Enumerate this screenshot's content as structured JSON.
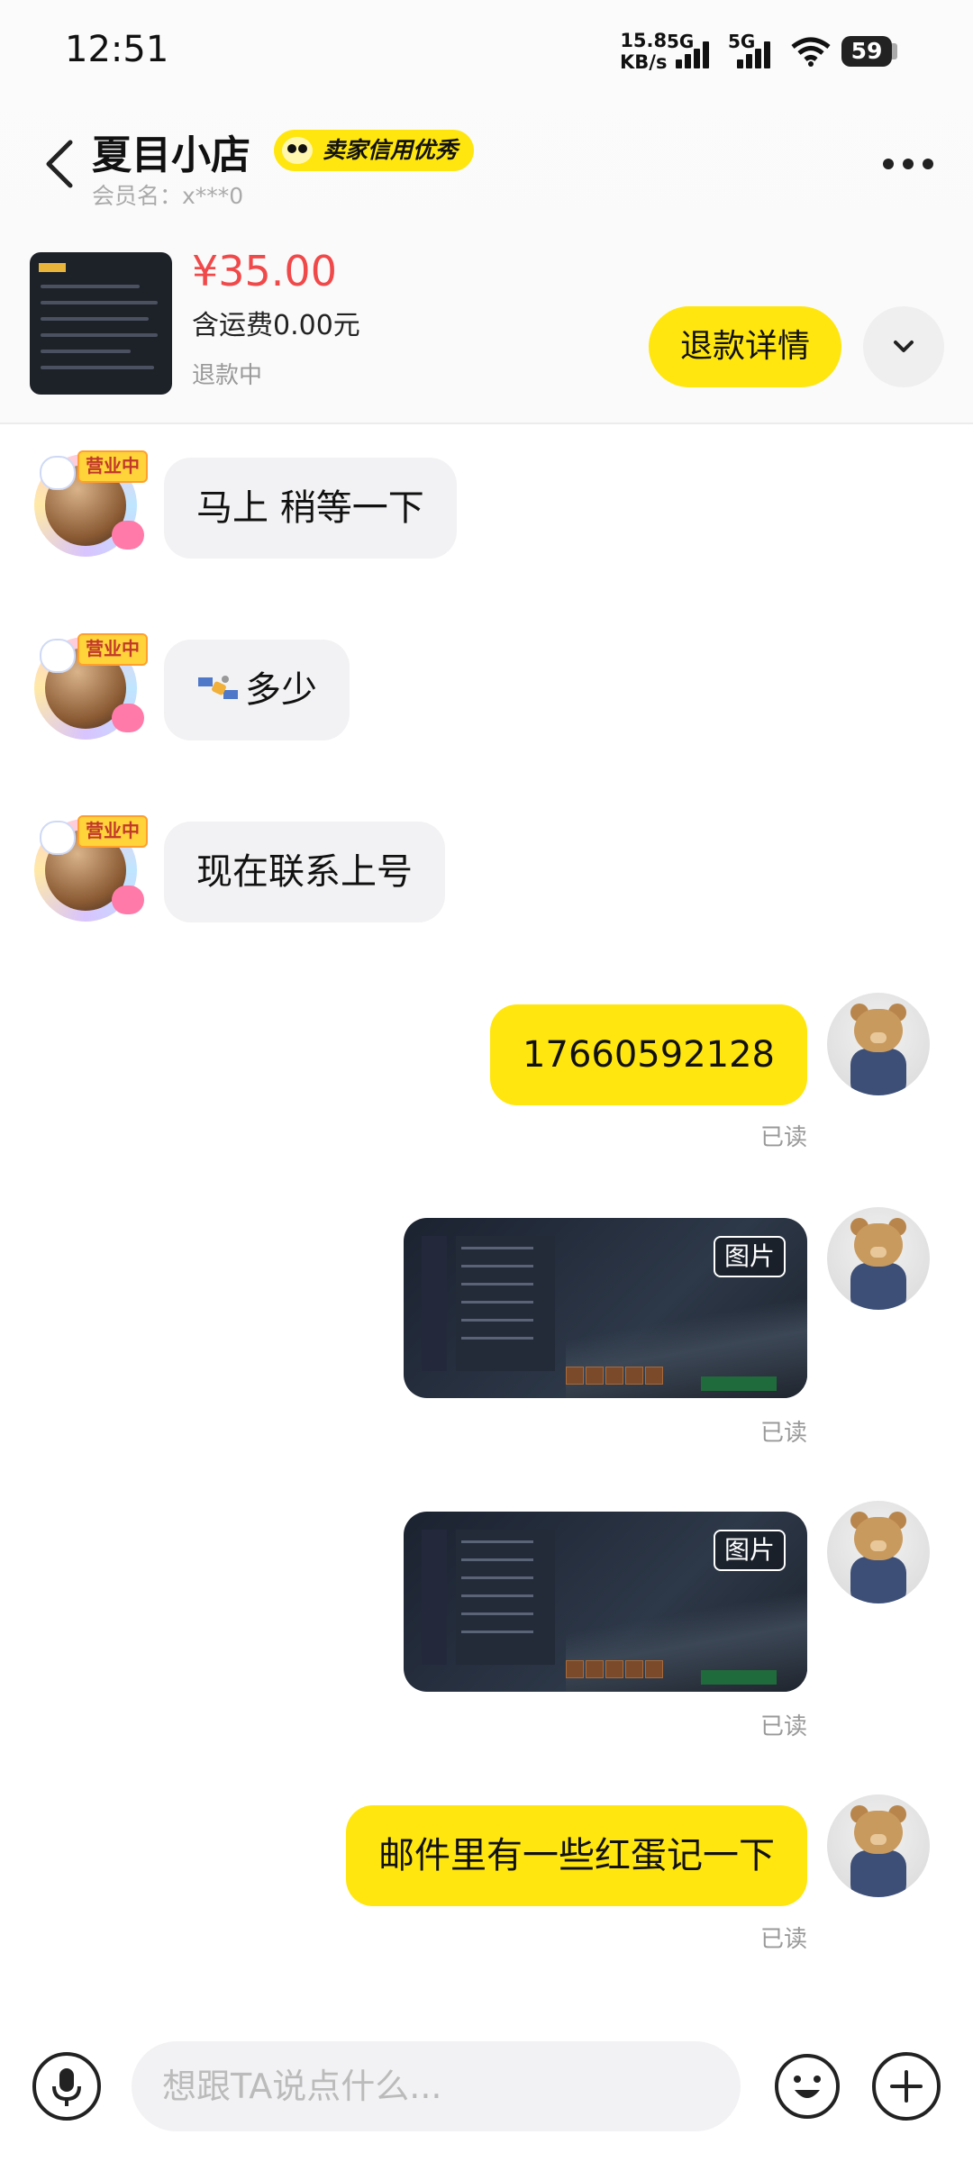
{
  "status_bar": {
    "time": "12:51",
    "speed_value": "15.8",
    "speed_unit": "KB/s",
    "net1": "5G",
    "net2": "5G",
    "battery": "59"
  },
  "header": {
    "shop_name": "夏目小店",
    "credit_badge": "卖家信用优秀",
    "member_label": "会员名：x***0"
  },
  "product": {
    "price": "¥35.00",
    "shipping": "含运费0.00元",
    "status": "退款中",
    "refund_button": "退款详情"
  },
  "messages": [
    {
      "side": "left",
      "text": "马上 稍等一下",
      "avatar_tag": "营业中"
    },
    {
      "side": "left",
      "text": "多少",
      "avatar_tag": "营业中"
    },
    {
      "side": "left",
      "text": "现在联系上号",
      "avatar_tag": "营业中"
    },
    {
      "side": "right",
      "text": "17660592128",
      "read": "已读"
    },
    {
      "side": "right",
      "type": "image",
      "badge": "图片",
      "read": "已读"
    },
    {
      "side": "right",
      "type": "image",
      "badge": "图片",
      "read": "已读"
    },
    {
      "side": "right",
      "text": "邮件里有一些红蛋记一下",
      "read": "已读"
    }
  ],
  "input_bar": {
    "placeholder": "想跟TA说点什么..."
  },
  "colors": {
    "accent_yellow": "#ffe60f",
    "price_red": "#f0494a",
    "bubble_gray": "#f2f2f4"
  },
  "icons": [
    "back-icon",
    "more-icon",
    "chevron-down-icon",
    "mic-icon",
    "emoji-icon",
    "plus-icon",
    "satellite-emoji-icon"
  ]
}
